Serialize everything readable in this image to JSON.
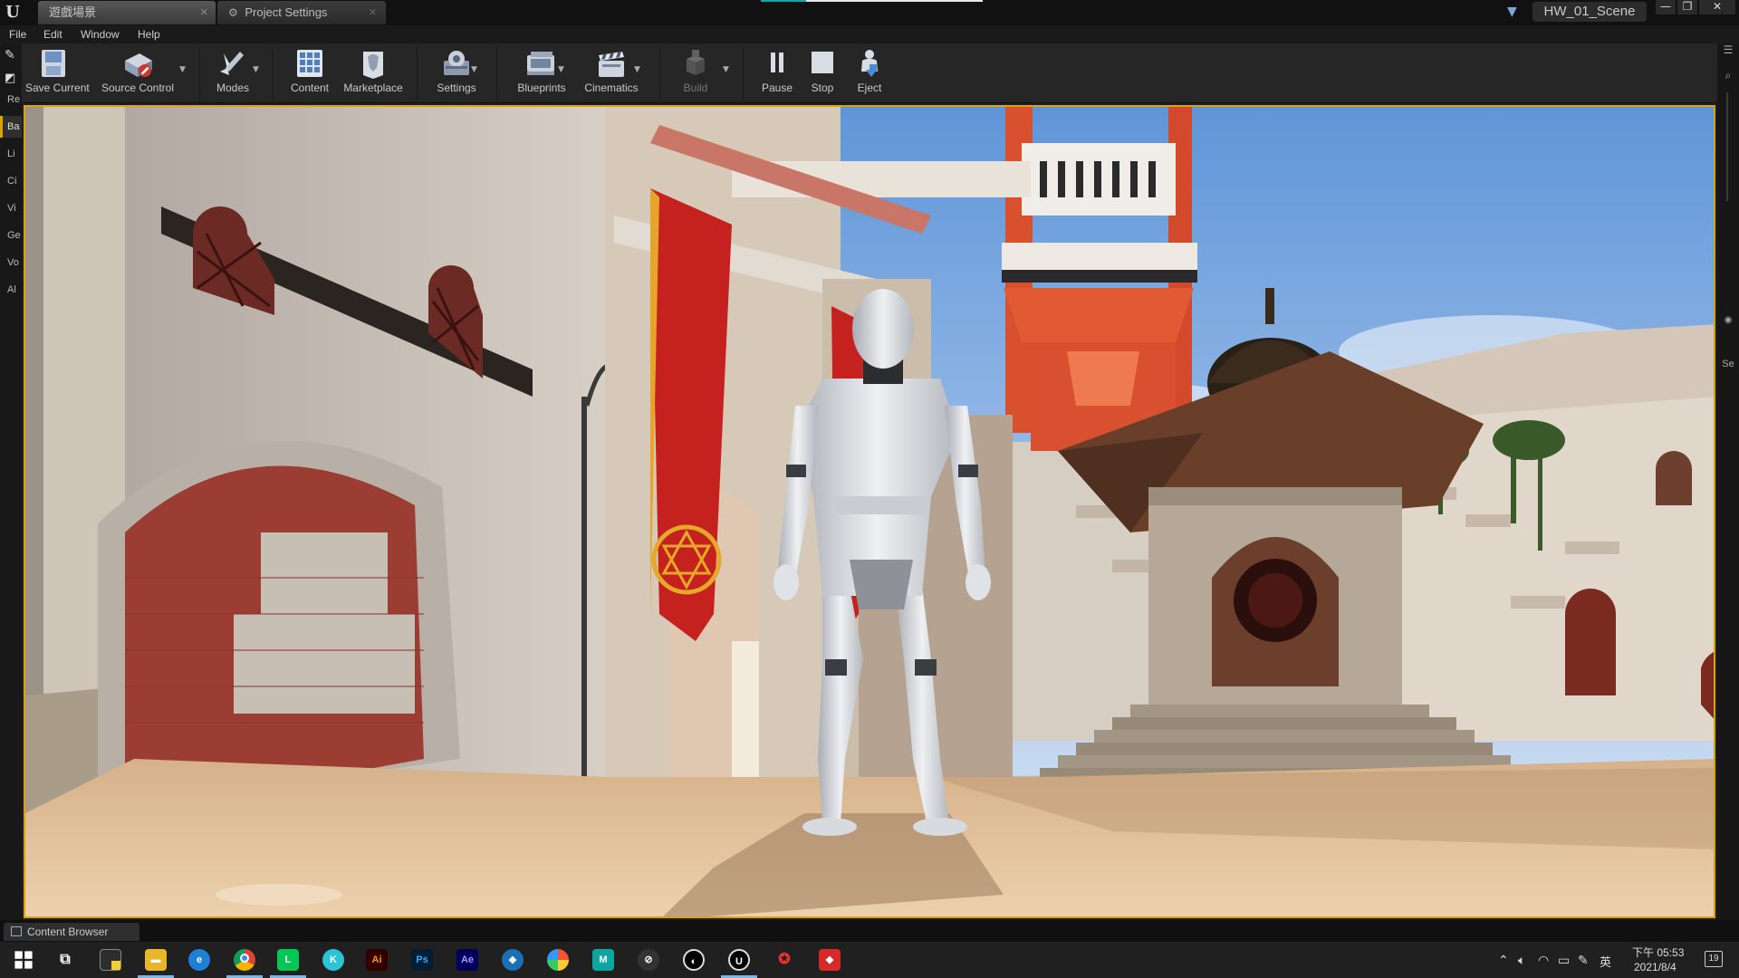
{
  "window": {
    "tabs": [
      {
        "label": "遊戲場景",
        "active": true
      },
      {
        "label": "Project Settings",
        "active": false
      }
    ],
    "project_name": "HW_01_Scene",
    "controls": {
      "minimize": "—",
      "maximize": "❐",
      "close": "✕"
    }
  },
  "menu": {
    "items": [
      "File",
      "Edit",
      "Window",
      "Help"
    ]
  },
  "toolbar": {
    "buttons": [
      {
        "label": "Save Current",
        "icon": "save-icon"
      },
      {
        "label": "Source Control",
        "icon": "source-control-icon",
        "dropdown": true
      },
      {
        "label": "Modes",
        "icon": "modes-icon",
        "dropdown": true
      },
      {
        "label": "Content",
        "icon": "content-icon"
      },
      {
        "label": "Marketplace",
        "icon": "marketplace-icon"
      },
      {
        "label": "Settings",
        "icon": "settings-icon",
        "dropdown": true
      },
      {
        "label": "Blueprints",
        "icon": "blueprints-icon",
        "dropdown": true
      },
      {
        "label": "Cinematics",
        "icon": "cinematics-icon",
        "dropdown": true
      },
      {
        "label": "Build",
        "icon": "build-icon",
        "dropdown": true,
        "disabled": true
      },
      {
        "label": "Pause",
        "icon": "pause-icon"
      },
      {
        "label": "Stop",
        "icon": "stop-icon"
      },
      {
        "label": "Eject",
        "icon": "eject-icon"
      }
    ]
  },
  "left_strip": {
    "items": [
      "Re",
      "Ba",
      "Li",
      "Ci",
      "Vi",
      "Ge",
      "Vo",
      "Al"
    ]
  },
  "right_strip": {
    "items": [
      "Se"
    ]
  },
  "viewport": {
    "scene": "desert town courtyard with mannequin character",
    "accent_color": "#d6a216"
  },
  "bottom": {
    "content_browser_label": "Content Browser"
  },
  "taskbar": {
    "apps": [
      "start",
      "task-view",
      "sticky-notes",
      "file-explorer",
      "edge",
      "chrome",
      "line",
      "klook",
      "Ai",
      "Ps",
      "Ae",
      "shield",
      "colorpicker",
      "M",
      "steam",
      "unity",
      "unreal",
      "bonjour",
      "pdf"
    ],
    "clock": {
      "time": "下午 05:53",
      "date": "2021/8/4"
    },
    "ime": "英",
    "notifications": "19"
  },
  "colors": {
    "accent_yellow": "#d6a216",
    "teal": "#19a4a4",
    "taskbar_bg": "#202020"
  }
}
